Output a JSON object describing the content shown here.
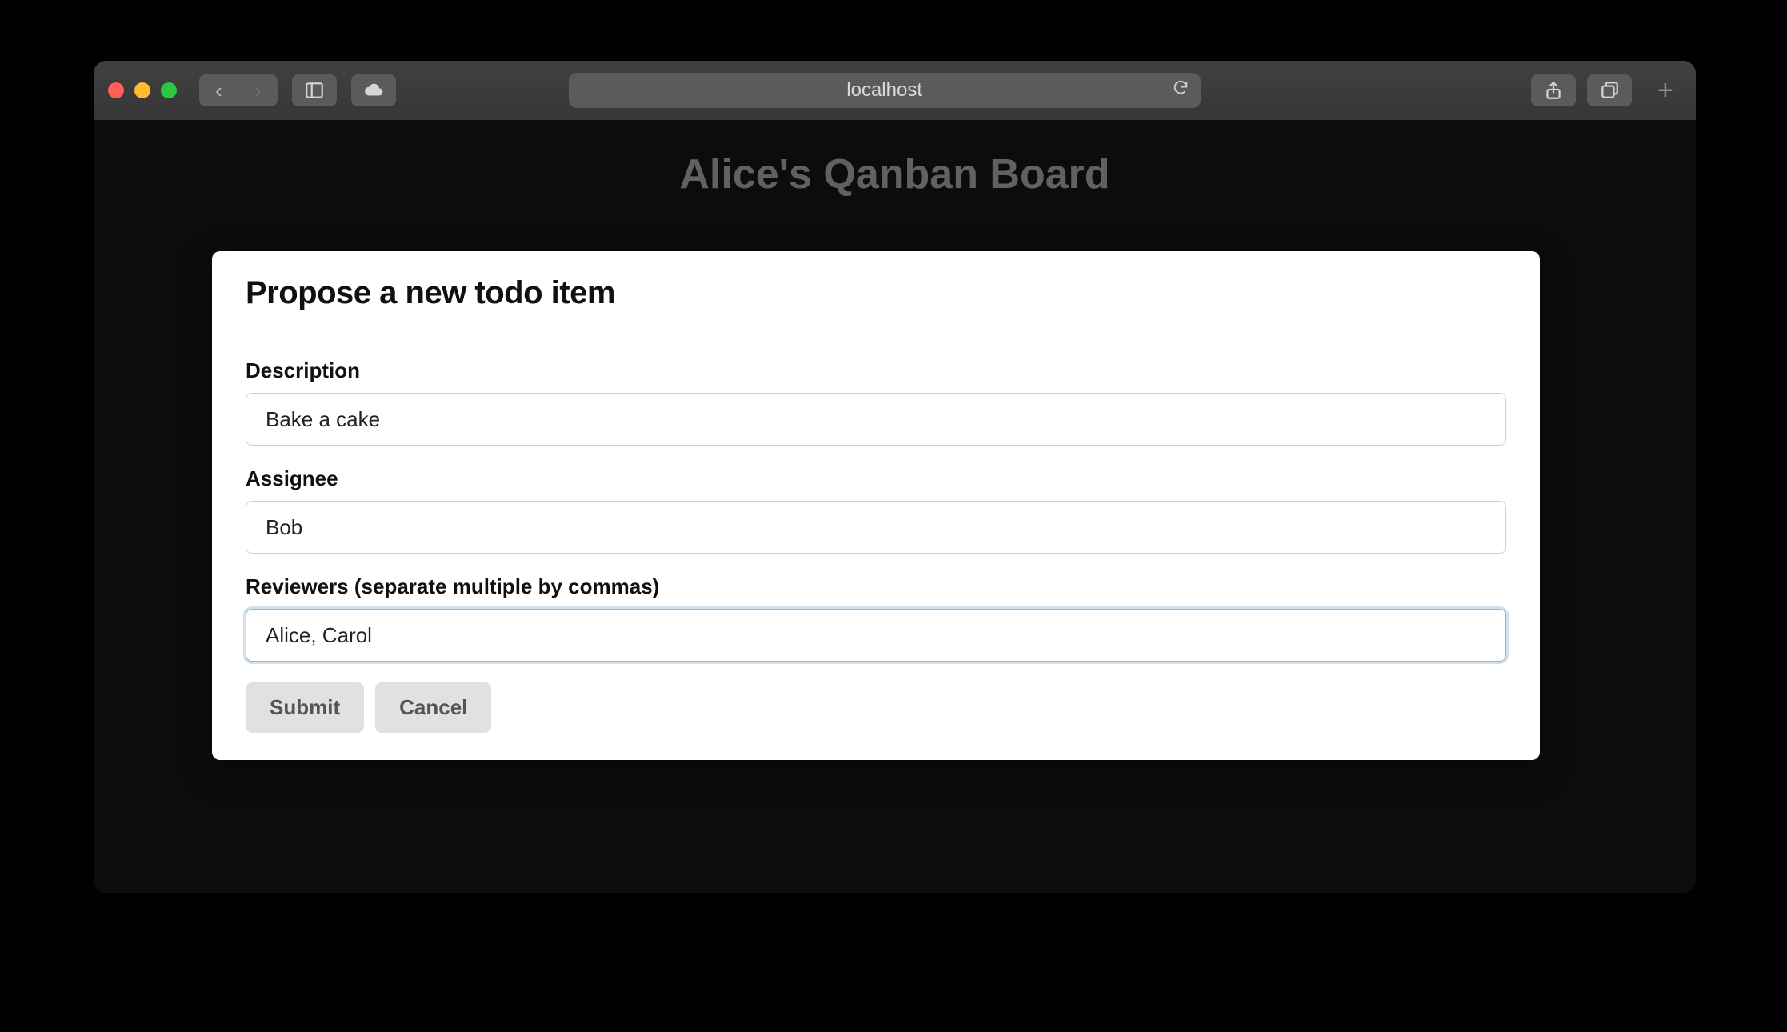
{
  "browser": {
    "url": "localhost"
  },
  "page": {
    "title": "Alice's Qanban Board"
  },
  "modal": {
    "title": "Propose a new todo item",
    "fields": {
      "description": {
        "label": "Description",
        "value": "Bake a cake"
      },
      "assignee": {
        "label": "Assignee",
        "value": "Bob"
      },
      "reviewers": {
        "label": "Reviewers (separate multiple by commas)",
        "value": "Alice, Carol"
      }
    },
    "buttons": {
      "submit": "Submit",
      "cancel": "Cancel"
    }
  }
}
